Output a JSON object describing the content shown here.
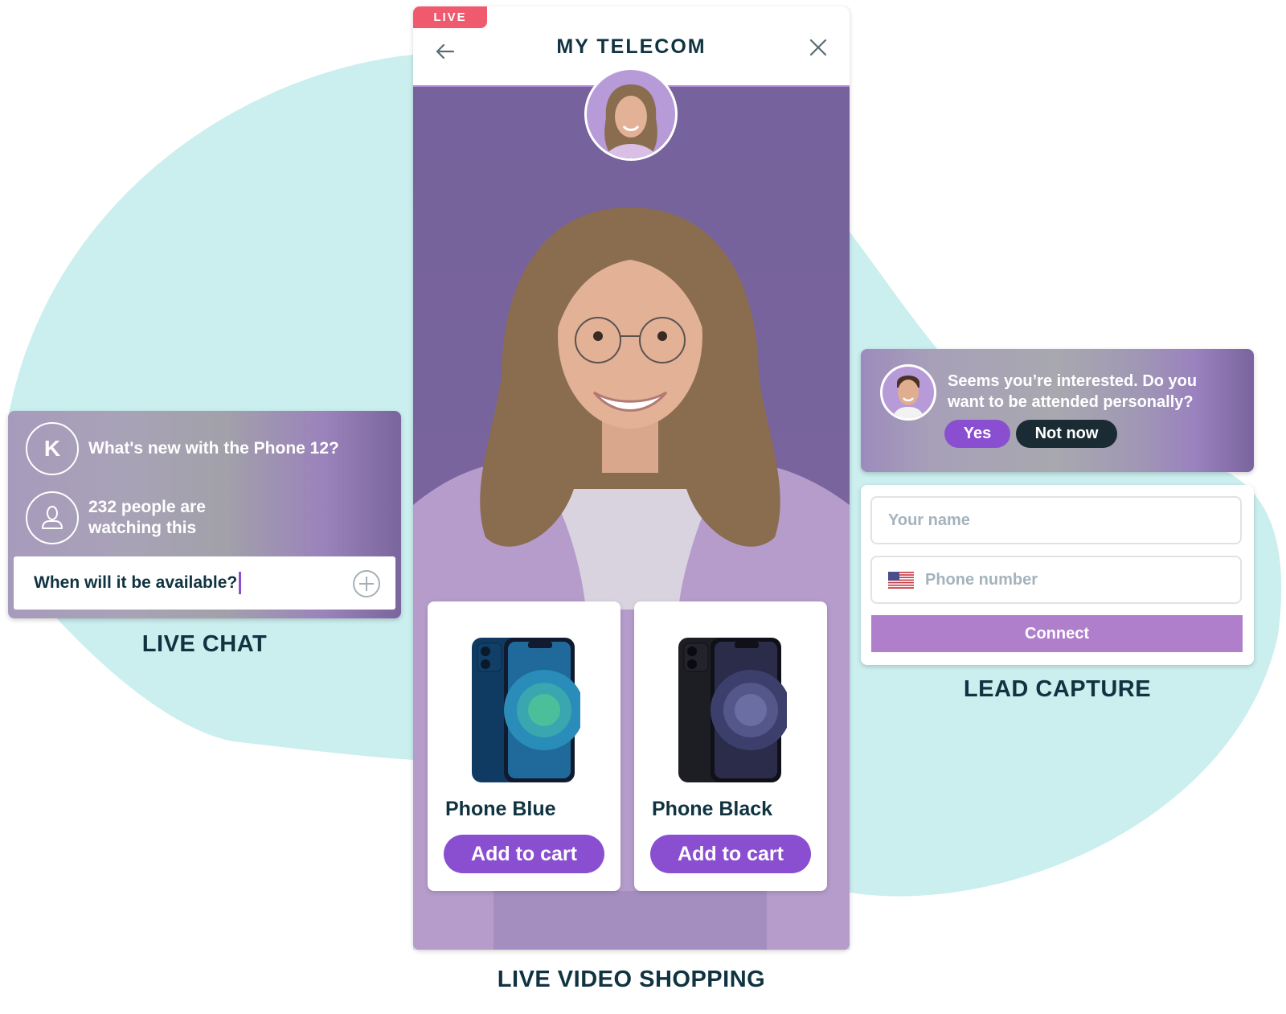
{
  "colors": {
    "background_blob": "#cbeeee",
    "brand_purple": "#8a4fd0",
    "connect_purple": "#b07fcc",
    "live_red": "#f05a6e",
    "dark_text": "#0f3340",
    "dark_button": "#1b2b33"
  },
  "live_video_shopping": {
    "live_badge": "LIVE",
    "title": "MY TELECOM",
    "back_icon": "arrow-left-icon",
    "close_icon": "close-icon",
    "products": [
      {
        "name": "Phone Blue",
        "button_label": "Add to cart",
        "color": "blue"
      },
      {
        "name": "Phone Black",
        "button_label": "Add to cart",
        "color": "black"
      }
    ],
    "section_label": "LIVE VIDEO SHOPPING"
  },
  "live_chat": {
    "messages": [
      {
        "avatar_letter": "K",
        "text": "What's new with the Phone 12?"
      },
      {
        "avatar_icon": "user-icon",
        "text_line1": "232 people are",
        "text_line2": "watching this"
      }
    ],
    "input_value": "When will it be available?",
    "add_icon": "plus-circle-icon",
    "section_label": "LIVE CHAT"
  },
  "lead_capture": {
    "message_line1": "Seems you’re interested. Do you",
    "message_line2": "want to be attended personally?",
    "yes_label": "Yes",
    "not_now_label": "Not now",
    "name_placeholder": "Your name",
    "phone_placeholder": "Phone number",
    "flag_icon": "us-flag-icon",
    "connect_label": "Connect",
    "section_label": "LEAD CAPTURE"
  }
}
